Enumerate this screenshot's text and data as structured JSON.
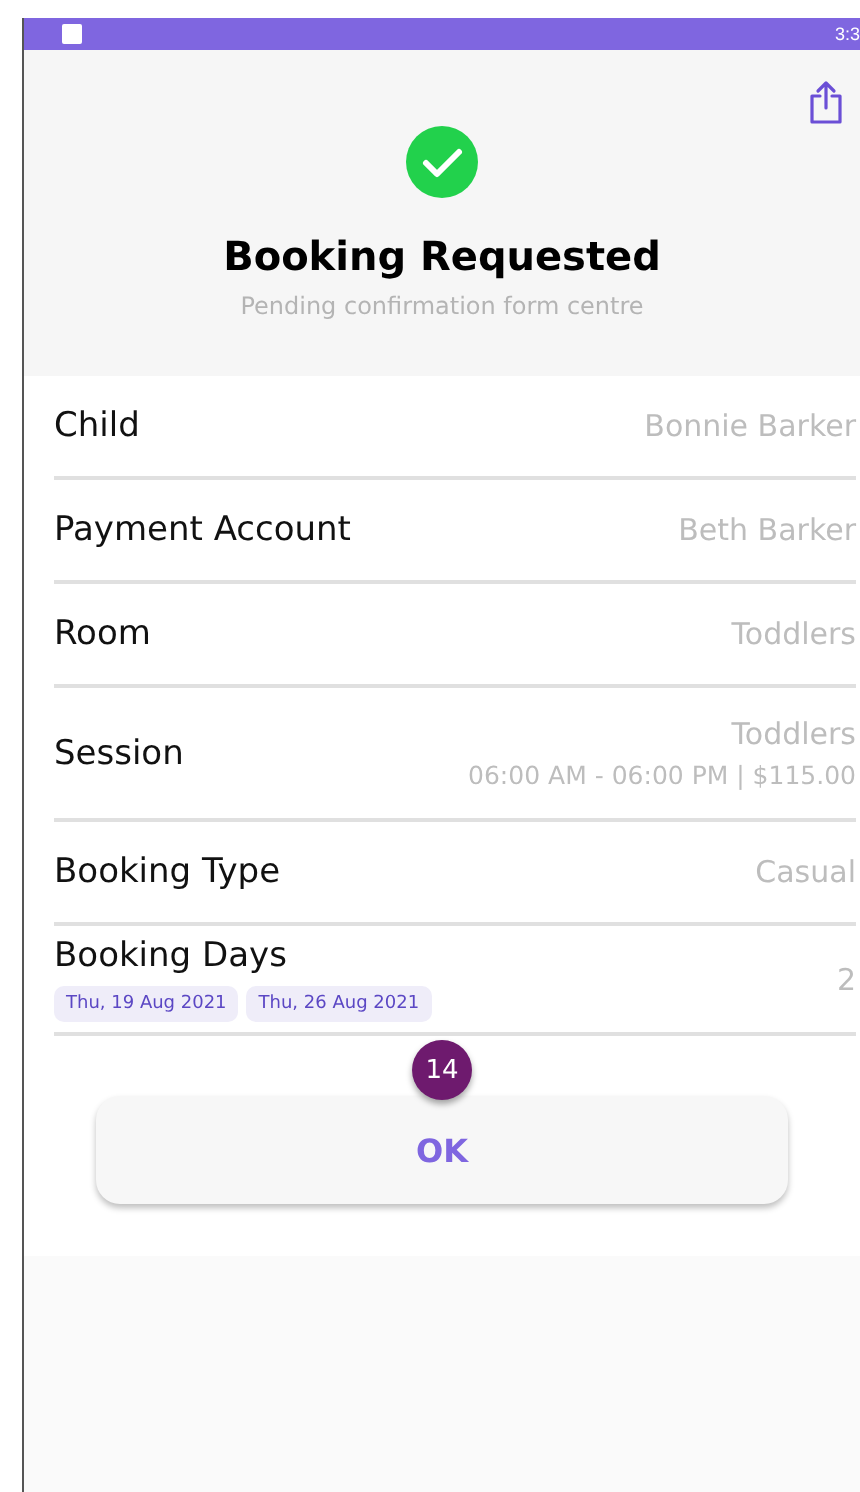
{
  "status_bar": {
    "time": "3:3"
  },
  "header": {
    "title": "Booking Requested",
    "subtitle": "Pending confirmation form centre"
  },
  "details": [
    {
      "kind": "plain",
      "label": "Child",
      "value": "Bonnie Barker"
    },
    {
      "kind": "plain",
      "label": "Payment Account",
      "value": "Beth Barker"
    },
    {
      "kind": "plain",
      "label": "Room",
      "value": "Toddlers"
    },
    {
      "kind": "session",
      "label": "Session",
      "value": "Toddlers",
      "detail": "06:00 AM - 06:00 PM | $115.00"
    },
    {
      "kind": "plain",
      "label": "Booking Type",
      "value": "Casual"
    },
    {
      "kind": "days",
      "label": "Booking Days",
      "value": "2",
      "days": [
        "Thu, 19 Aug 2021",
        "Thu, 26 Aug 2021"
      ]
    }
  ],
  "badge": "14",
  "buttons": [
    "OK"
  ]
}
